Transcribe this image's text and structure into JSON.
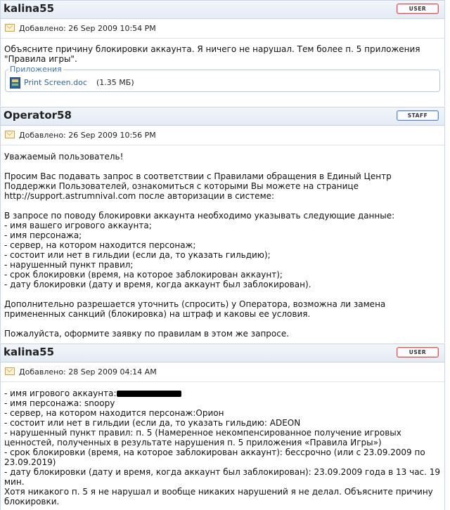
{
  "posts": [
    {
      "author": "kalina55",
      "badge": "USER",
      "date": "Добавлено: 26 Sep 2009 10:54 PM",
      "body": "Объясните причину блокировки аккаунта. Я ничего не нарушал. Тем более п. 5 приложения \"Правила игры\".",
      "attachments_label": "Приложения",
      "attachment": {
        "name": "Print Screen.doc",
        "size": "(1.35 МБ)"
      }
    },
    {
      "author": "Operator58",
      "badge": "STAFF",
      "date": "Добавлено: 26 Sep 2009 10:56 PM",
      "body_a": "Уважаемый пользователь!\n\nПросим Вас подавать запрос в соответствии с Правилами обращения в Единый Центр Поддержки Пользователей, ознакомиться с которыми Вы можете на странице",
      "link": "http://support.astrumnival.com",
      "body_b": " после авторизации в системе:\n\nВ запросе по поводу блокировки аккаунта необходимо указывать следующие данные:\n- имя вашего игрового аккаунта;\n- имя персонажа;\n- сервер, на котором находится персонаж;\n- состоит или нет в гильдии (если да, то указать гильдию);\n- нарушенный пункт правил;\n- срок блокировки (время, на которое заблокирован аккаунт);\n- дату блокировки (дату и время, когда аккаунт был заблокирован).\n\nДополнительно разрешается уточнить (спросить) у Оператора, возможна ли замена примененных санкций (блокировка) на штраф и каковы ее условия.\n\nПожалуйста, оформите заявку по правилам в этом же запросе."
    },
    {
      "author": "kalina55",
      "badge": "USER",
      "date": "Добавлено: 28 Sep 2009 04:14 AM",
      "line1": "- имя игрового аккаунта:",
      "body_rest": "- имя персонажа: snoopy\n- сервер, на котором находится персонаж:Орион\n- состоит или нет в гильдии (если да, то указать гильдию: ADEON\n- нарушенный пункт правил: п. 5 (Намеренное некомпенсированное получение игровых ценностей, полученных в результате нарушения п. 5 приложения «Правила Игры»)\n- срок блокировки (время, на которое заблокирован аккаунт): бессрочно (или с 23.09.2009 по 23.09.2019)\n- дату блокировки (дату и время, когда аккаунт был заблокирован): 23.09.2009 года в 13 час. 19 мин.\nХотя никакого п. 5 я не нарушал и вообще никаких нарушений я не делал. Объясните причину блокировки."
    }
  ]
}
